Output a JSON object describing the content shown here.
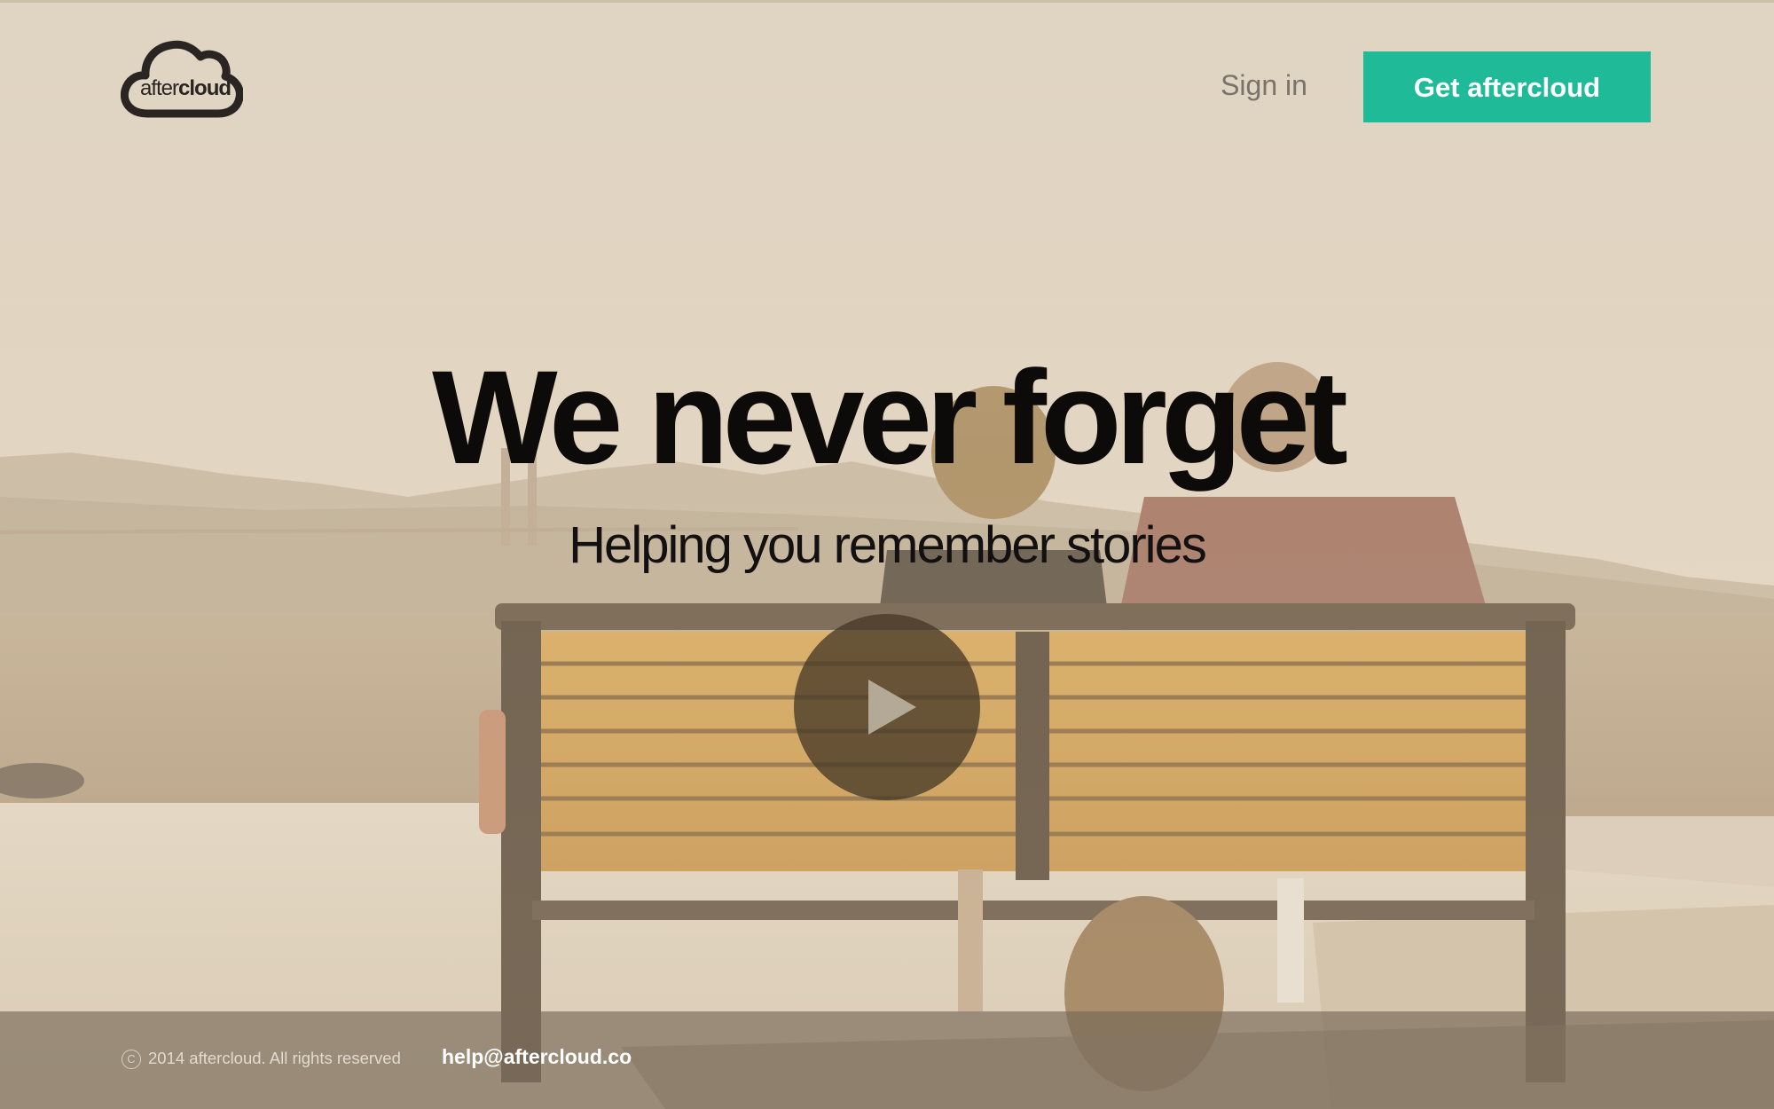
{
  "brand": {
    "logo_regular": "after",
    "logo_bold": "cloud",
    "accent_color": "#1fbb98"
  },
  "nav": {
    "signin_label": "Sign in",
    "cta_label": "Get aftercloud"
  },
  "hero": {
    "headline": "We never forget",
    "subheadline": "Helping you remember stories",
    "play_icon": "play-icon"
  },
  "footer": {
    "copyright_icon": "copyright-icon",
    "copyright_text": "2014 aftercloud. All rights reserved",
    "email": "help@aftercloud.co"
  }
}
